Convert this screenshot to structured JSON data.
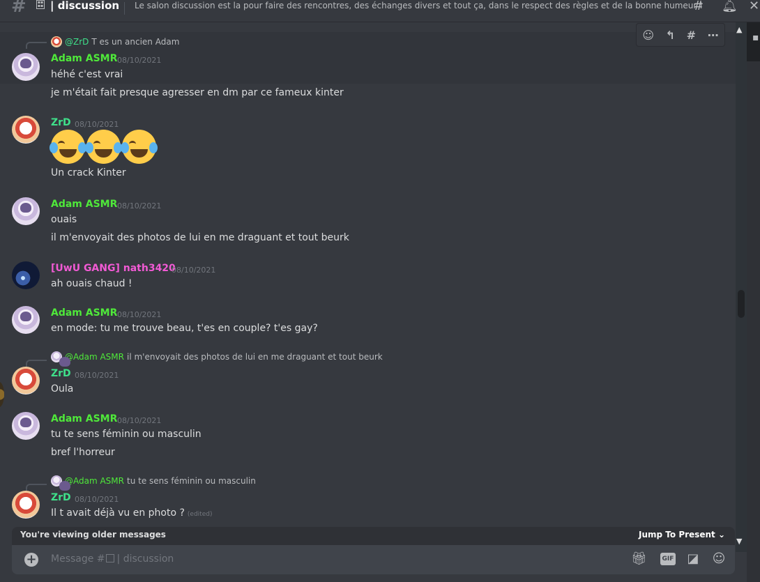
{
  "header": {
    "channel_name": "discussion",
    "topic": "Le salon discussion est la pour faire des rencontres, des échanges divers et tout ça, dans le respect des règles et de la bonne humeur !",
    "icons": [
      "threads-icon",
      "bell-icon",
      "close-icon"
    ]
  },
  "message_toolbar": {
    "icons": [
      "add-reaction-icon",
      "reply-icon",
      "create-thread-icon",
      "more-icon"
    ]
  },
  "messages": [
    {
      "reply": {
        "mention": "@ZrD",
        "text": "T es un ancien Adam"
      },
      "author": "Adam ASMR",
      "timestamp": "08/10/2021",
      "lines": [
        "héhé c'est vrai",
        "je m'était fait presque agresser en dm par ce fameux kinter"
      ]
    },
    {
      "author": "ZrD",
      "timestamp": "08/10/2021",
      "emoji": [
        "face-with-tears-of-joy",
        "face-with-tears-of-joy",
        "face-with-tears-of-joy"
      ],
      "lines": [
        "Un crack Kinter"
      ]
    },
    {
      "author": "Adam ASMR",
      "timestamp": "08/10/2021",
      "lines": [
        "ouais",
        "il m'envoyait des photos de lui en me draguant et tout beurk"
      ]
    },
    {
      "author": "[UwU GANG] nath3420",
      "timestamp": "08/10/2021",
      "lines": [
        "ah ouais chaud !"
      ]
    },
    {
      "author": "Adam ASMR",
      "timestamp": "08/10/2021",
      "lines": [
        "en mode: tu me trouve beau, t'es en couple? t'es gay?"
      ]
    },
    {
      "reply": {
        "mention": "@Adam ASMR",
        "text": "il m'envoyait des photos de lui en me draguant et tout beurk"
      },
      "author": "ZrD",
      "timestamp": "08/10/2021",
      "lines": [
        "Oula"
      ]
    },
    {
      "author": "Adam ASMR",
      "timestamp": "08/10/2021",
      "lines": [
        "tu te sens féminin ou masculin",
        "bref l'horreur"
      ]
    },
    {
      "reply": {
        "mention": "@Adam ASMR",
        "text": "tu te sens féminin ou masculin"
      },
      "author": "ZrD",
      "timestamp": "08/10/2021",
      "lines": [
        "Il t avait déjà vu en photo ?"
      ],
      "edited": "(edited)"
    }
  ],
  "older_bar": {
    "label": "You're viewing older messages",
    "jump_label": "Jump To Present"
  },
  "composer": {
    "placeholder_prefix": "Message #",
    "placeholder_channel": "discussion",
    "gif_label": "GIF",
    "icons": [
      "gift-icon",
      "gif-icon",
      "sticker-icon",
      "emoji-icon"
    ]
  },
  "colors": {
    "background": "#36393f",
    "adam": "#4fe83a",
    "zrd": "#3fe08a",
    "nath": "#f15ad4"
  }
}
